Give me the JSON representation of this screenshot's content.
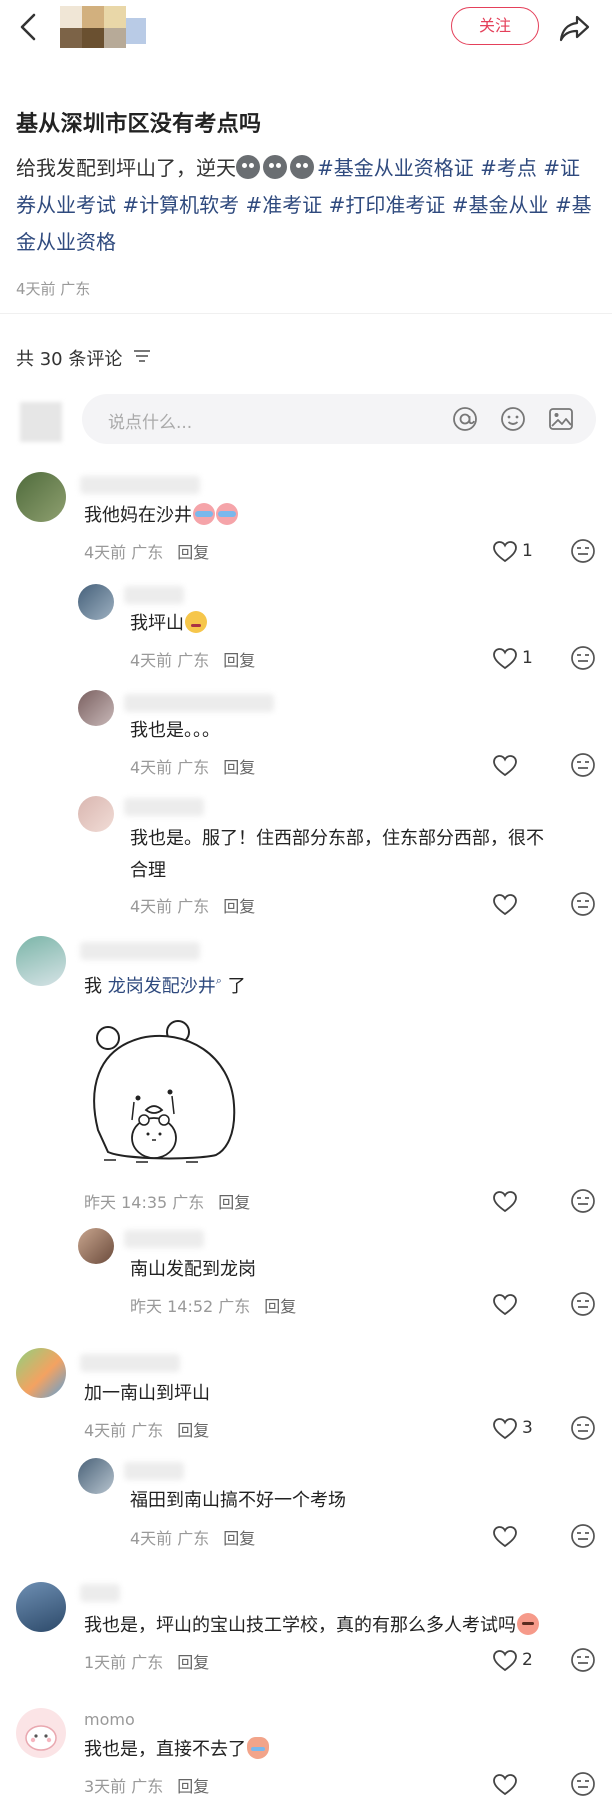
{
  "header": {
    "follow_label": "关注"
  },
  "note": {
    "title": "基从深圳市区没有考点吗",
    "body_prefix": "给我发配到坪山了，逆天",
    "tags": [
      "#基金从业资格证",
      "#考点",
      "#证券从业考试",
      "#计算机软考",
      "#准考证",
      "#打印准考证",
      "#基金从业",
      "#基金从业资格"
    ],
    "meta": "4天前 广东"
  },
  "comments_header": {
    "count_label": "共 30 条评论"
  },
  "input": {
    "placeholder": "说点什么..."
  },
  "comments": [
    {
      "text": "我他妈在沙井",
      "meta": "4天前 广东",
      "reply": "回复",
      "likes": "1"
    },
    {
      "text": "我坪山",
      "meta": "4天前 广东",
      "reply": "回复",
      "likes": "1"
    },
    {
      "text": "我也是。。。",
      "meta": "4天前 广东",
      "reply": "回复",
      "likes": ""
    },
    {
      "text_line1": "我也是。服了！住西部分东部，住东部分西部，很不",
      "text_line2": "合理",
      "meta": "4天前 广东",
      "reply": "回复",
      "likes": ""
    },
    {
      "text_prefix": "我 ",
      "mention": "龙岗发配沙井",
      "text_suffix": " 了",
      "meta": "昨天 14:35 广东",
      "reply": "回复",
      "likes": ""
    },
    {
      "text": "南山发配到龙岗",
      "meta": "昨天 14:52 广东",
      "reply": "回复",
      "likes": ""
    },
    {
      "text": "加一南山到坪山",
      "meta": "4天前 广东",
      "reply": "回复",
      "likes": "3"
    },
    {
      "text": "福田到南山搞不好一个考场",
      "meta": "4天前 广东",
      "reply": "回复",
      "likes": ""
    },
    {
      "text": "我也是，坪山的宝山技工学校，真的有那么多人考试吗",
      "meta": "1天前 广东",
      "reply": "回复",
      "likes": "2"
    },
    {
      "name": "momo",
      "text": "我也是，直接不去了",
      "meta": "3天前 广东",
      "reply": "回复",
      "likes": ""
    }
  ],
  "colors": {
    "accent": "#e4405a",
    "tag": "#2f4a7e",
    "muted": "#999999"
  }
}
